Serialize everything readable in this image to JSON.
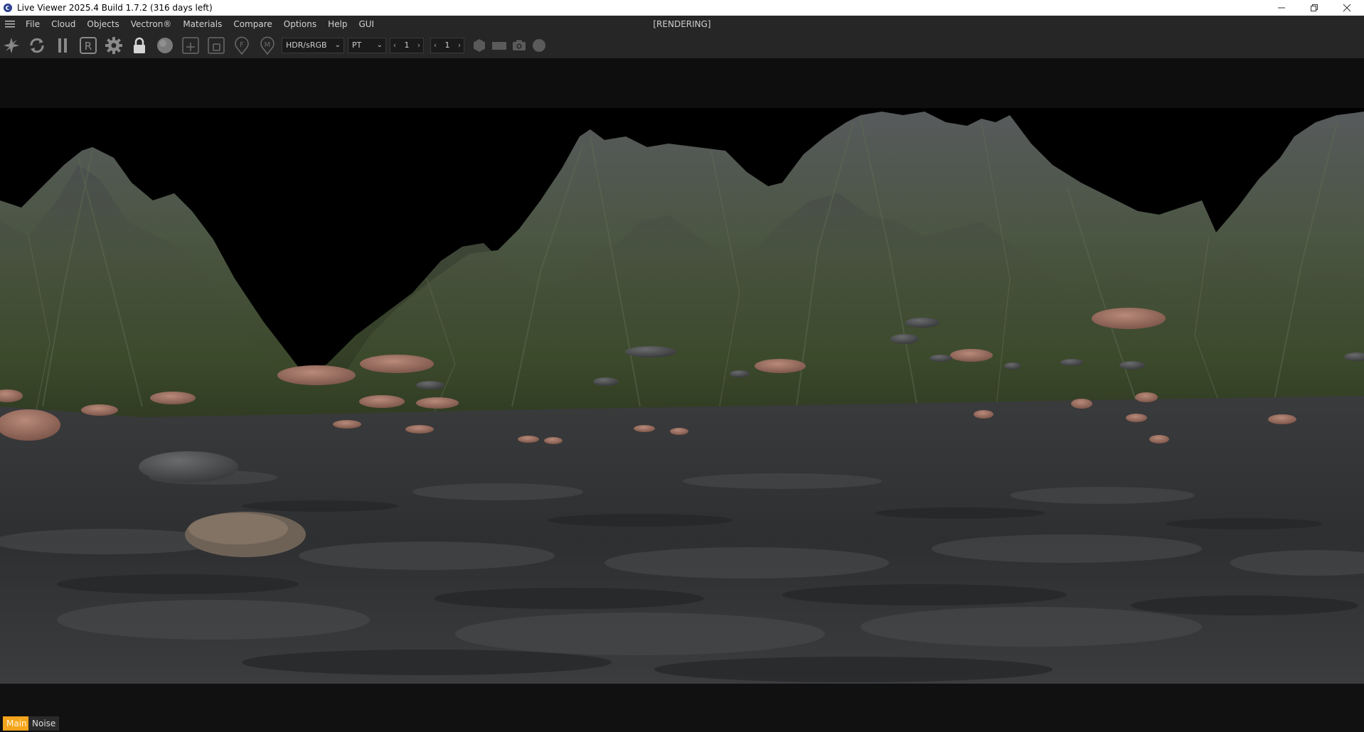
{
  "window": {
    "title": "Live Viewer 2025.4 Build 1.7.2 (316 days left)",
    "controls": [
      "minimize-icon",
      "restore-icon",
      "close-icon"
    ]
  },
  "menubar": {
    "items": [
      "File",
      "Cloud",
      "Objects",
      "Vectron®",
      "Materials",
      "Compare",
      "Options",
      "Help",
      "GUI"
    ],
    "status": "[RENDERING]"
  },
  "toolbar": {
    "icons": [
      "spark-icon",
      "refresh-icon",
      "pause-icon",
      "render-region-icon",
      "settings-gear-icon",
      "lock-icon",
      "sphere-icon",
      "add-frame-icon",
      "region-frame-icon",
      "focus-pin-icon",
      "material-pin-icon"
    ],
    "render_region_letter": "R",
    "focus_letter": "F",
    "material_letter": "M",
    "colorspace": {
      "selected": "HDR/sRGB"
    },
    "kernel": {
      "selected": "PT"
    },
    "stepper1": {
      "value": "1"
    },
    "stepper2": {
      "value": "1"
    },
    "right_icons": [
      "hexagon-icon",
      "rectangle-icon",
      "camera-icon",
      "circle-icon"
    ]
  },
  "bottom_tabs": {
    "main": "Main",
    "noise": "Noise",
    "active_color": "#f5a51c"
  },
  "render": {
    "description_colors": {
      "sky": "#000000",
      "mountain": "#3f4a36",
      "ground": "#3a3b3d",
      "pebble": "#9c6b5c"
    }
  }
}
